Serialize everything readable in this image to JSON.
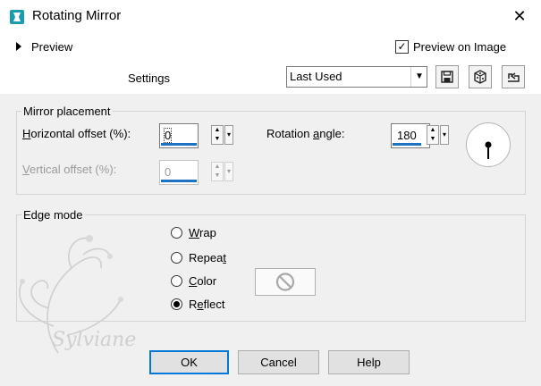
{
  "window": {
    "title": "Rotating Mirror",
    "close_glyph": "✕"
  },
  "preview": {
    "label": "Preview",
    "preview_on_image_label": "Preview on Image",
    "preview_on_image_checked": true
  },
  "settings": {
    "label": "Settings",
    "preset_value": "Last Used",
    "toolbar_icons": [
      "save-icon",
      "random-dice-icon",
      "reset-icon"
    ]
  },
  "mirror_placement": {
    "group_label": "Mirror placement",
    "horizontal_offset": {
      "label_u": "H",
      "label_rest": "orizontal offset (%):",
      "value": "0"
    },
    "vertical_offset": {
      "label_u": "V",
      "label_rest": "ertical offset (%):",
      "value": "0",
      "enabled": false
    },
    "rotation_angle": {
      "label_pre": "Rotation ",
      "label_u": "a",
      "label_rest": "ngle:",
      "value": "180"
    }
  },
  "edge_mode": {
    "group_label": "Edge mode",
    "options": [
      {
        "u": "W",
        "rest": "rap",
        "selected": false
      },
      {
        "pre": "Repea",
        "u": "t",
        "rest": "",
        "selected": false
      },
      {
        "u": "C",
        "rest": "olor",
        "selected": false
      },
      {
        "pre": "R",
        "u": "e",
        "rest": "flect",
        "selected": true
      }
    ]
  },
  "buttons": {
    "ok": "OK",
    "cancel": "Cancel",
    "help": "Help"
  },
  "watermark": {
    "text": "Sylviane"
  },
  "colors": {
    "accent": "#1e72c4",
    "dialog_bg": "#f0f0f0",
    "icon_teal": "#1a9bb0"
  }
}
